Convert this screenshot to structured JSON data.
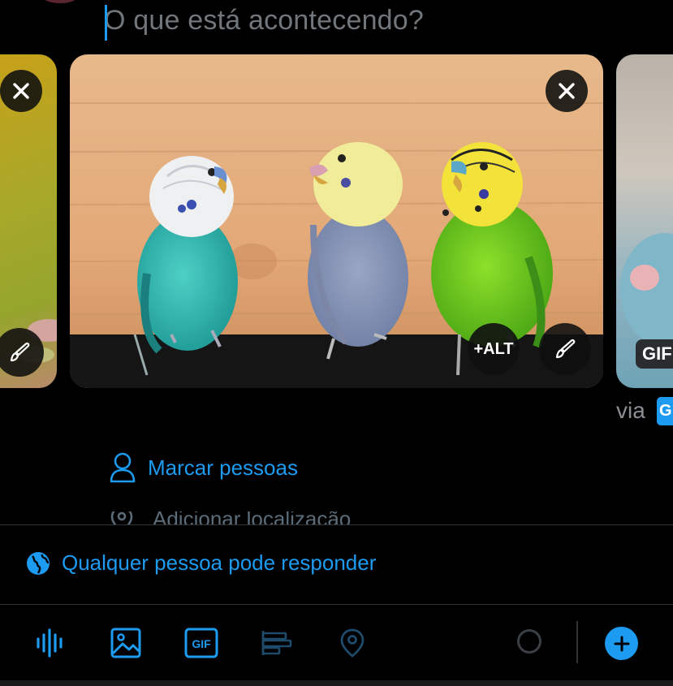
{
  "composer": {
    "placeholder": "O que está acontecendo?"
  },
  "media": {
    "alt_label": "+ALT",
    "gif_badge": "GIF",
    "via_label": "via",
    "giphy_logo_text": "G"
  },
  "options": {
    "tag_people": "Marcar pessoas",
    "add_location": "Adicionar localização"
  },
  "reply_setting": {
    "label": "Qualquer pessoa pode responder"
  },
  "toolbar": {
    "icons": [
      "audio-wave-icon",
      "image-icon",
      "gif-icon",
      "poll-icon",
      "location-icon"
    ],
    "add_button_icon": "plus-icon"
  },
  "colors": {
    "accent": "#1d9bf0",
    "background": "#000000",
    "muted": "#71767b"
  }
}
